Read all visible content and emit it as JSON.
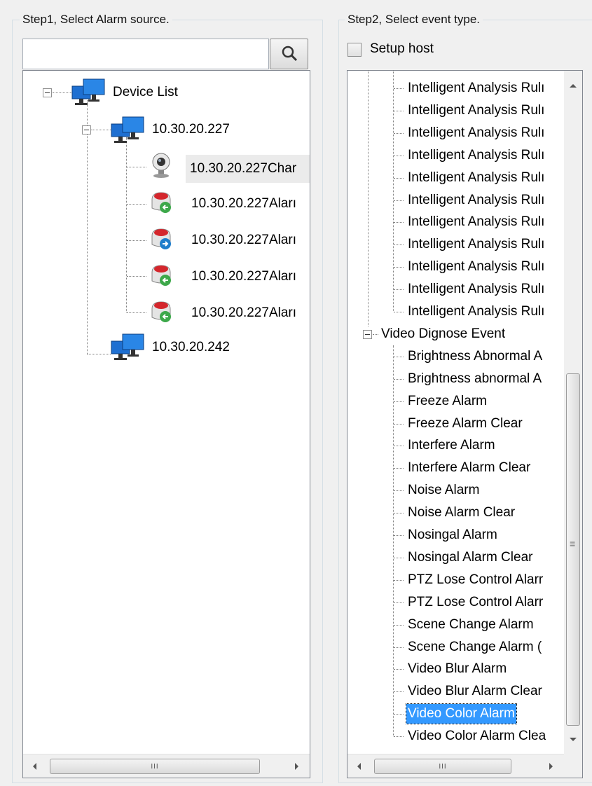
{
  "step1": {
    "title": "Step1, Select Alarm source.",
    "search": {
      "value": "",
      "placeholder": ""
    },
    "search_icon": "search-icon",
    "tree": {
      "root": "Device List",
      "device1": "10.30.20.227",
      "device1_children": [
        "10.30.20.227Char",
        "10.30.20.227Aları",
        "10.30.20.227Aları",
        "10.30.20.227Aları",
        "10.30.20.227Aları"
      ],
      "device2": "10.30.20.242"
    },
    "hscroll_thumb": "III"
  },
  "step2": {
    "title": "Step2, Select event type.",
    "setup_host_label": "Setup host",
    "setup_host_checked": false,
    "intelligent_items": [
      "Intelligent Analysis Rulı",
      "Intelligent Analysis Rulı",
      "Intelligent Analysis Rulı",
      "Intelligent Analysis Rulı",
      "Intelligent Analysis Rulı",
      "Intelligent Analysis Rulı",
      "Intelligent Analysis Rulı",
      "Intelligent Analysis Rulı",
      "Intelligent Analysis Rulı",
      "Intelligent Analysis Rulı",
      "Intelligent Analysis Rulı"
    ],
    "video_group": "Video Dignose Event",
    "video_items": [
      "Brightness Abnormal A",
      "Brightness abnormal A",
      "Freeze Alarm",
      "Freeze Alarm Clear",
      "Interfere Alarm",
      "Interfere Alarm Clear",
      "Noise Alarm",
      "Noise Alarm Clear",
      "Nosingal Alarm",
      "Nosingal Alarm Clear",
      "PTZ Lose Control Alarr",
      "PTZ Lose Control Alarr",
      "Scene Change Alarm",
      "Scene Change Alarm (",
      "Video Blur Alarm",
      "Video Blur Alarm Clear",
      "Video Color Alarm",
      "Video Color Alarm Clea"
    ],
    "selected_item": "Video Color Alarm",
    "hscroll_thumb": "III",
    "vscroll_grip": "≡"
  },
  "colors": {
    "selection": "#3399ff",
    "monitor_blue": "#1e6fd1",
    "alarm_red": "#d4262c",
    "alarm_green": "#3da84a",
    "alarm_blue": "#1f7ecb"
  }
}
